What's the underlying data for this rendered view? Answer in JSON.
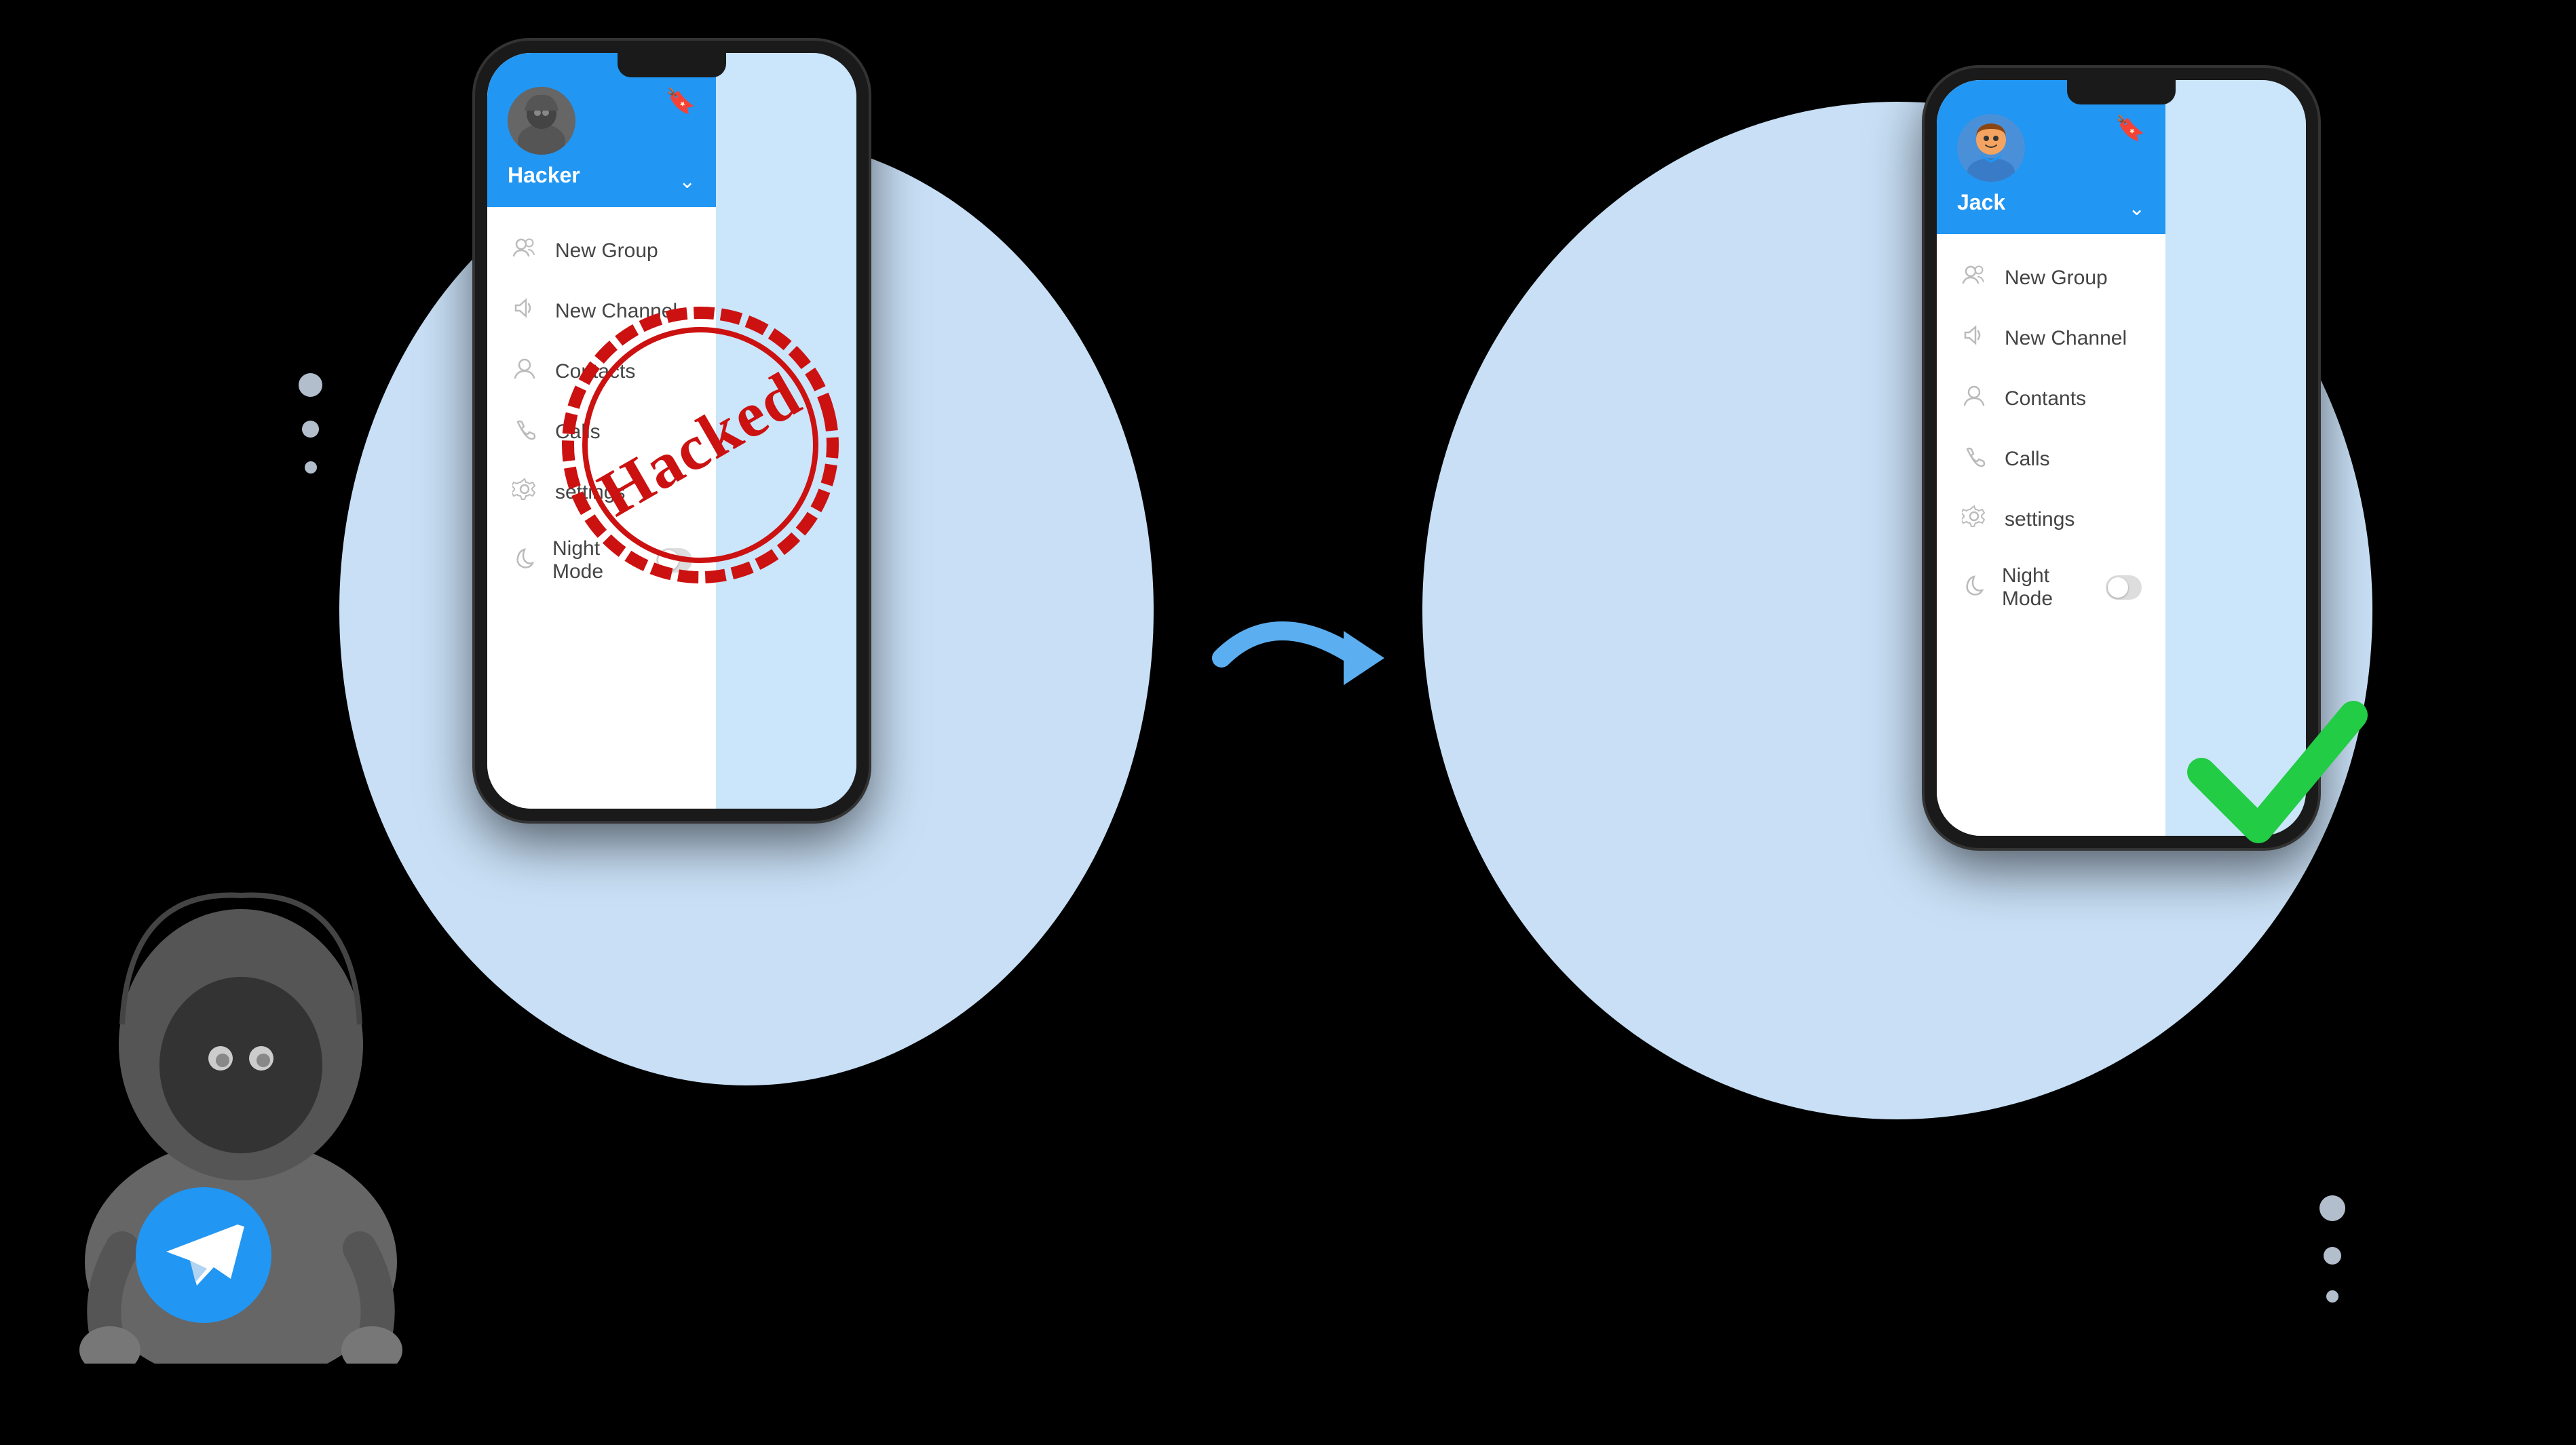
{
  "left_phone": {
    "user": {
      "name": "Hacker",
      "avatar_type": "hacker"
    },
    "menu": [
      {
        "icon": "👥",
        "label": "New Group"
      },
      {
        "icon": "📢",
        "label": "New Channel"
      },
      {
        "icon": "👤",
        "label": "Contacts"
      },
      {
        "icon": "📞",
        "label": "Calls"
      },
      {
        "icon": "⚙️",
        "label": "settings"
      },
      {
        "icon": "🌙",
        "label": "Night Mode",
        "has_toggle": true
      }
    ],
    "stamp": "Hacked"
  },
  "right_phone": {
    "user": {
      "name": "Jack",
      "avatar_type": "jack"
    },
    "menu": [
      {
        "icon": "👥",
        "label": "New Group"
      },
      {
        "icon": "📢",
        "label": "New Channel"
      },
      {
        "icon": "👤",
        "label": "Contants"
      },
      {
        "icon": "📞",
        "label": "Calls"
      },
      {
        "icon": "⚙️",
        "label": "settings"
      },
      {
        "icon": "🌙",
        "label": "Night Mode",
        "has_toggle": true
      }
    ]
  },
  "arrow": "→",
  "colors": {
    "telegram_blue": "#2196F3",
    "background_blob": "#c8dff5",
    "stamp_red": "#cc1111",
    "check_green": "#22cc44"
  }
}
